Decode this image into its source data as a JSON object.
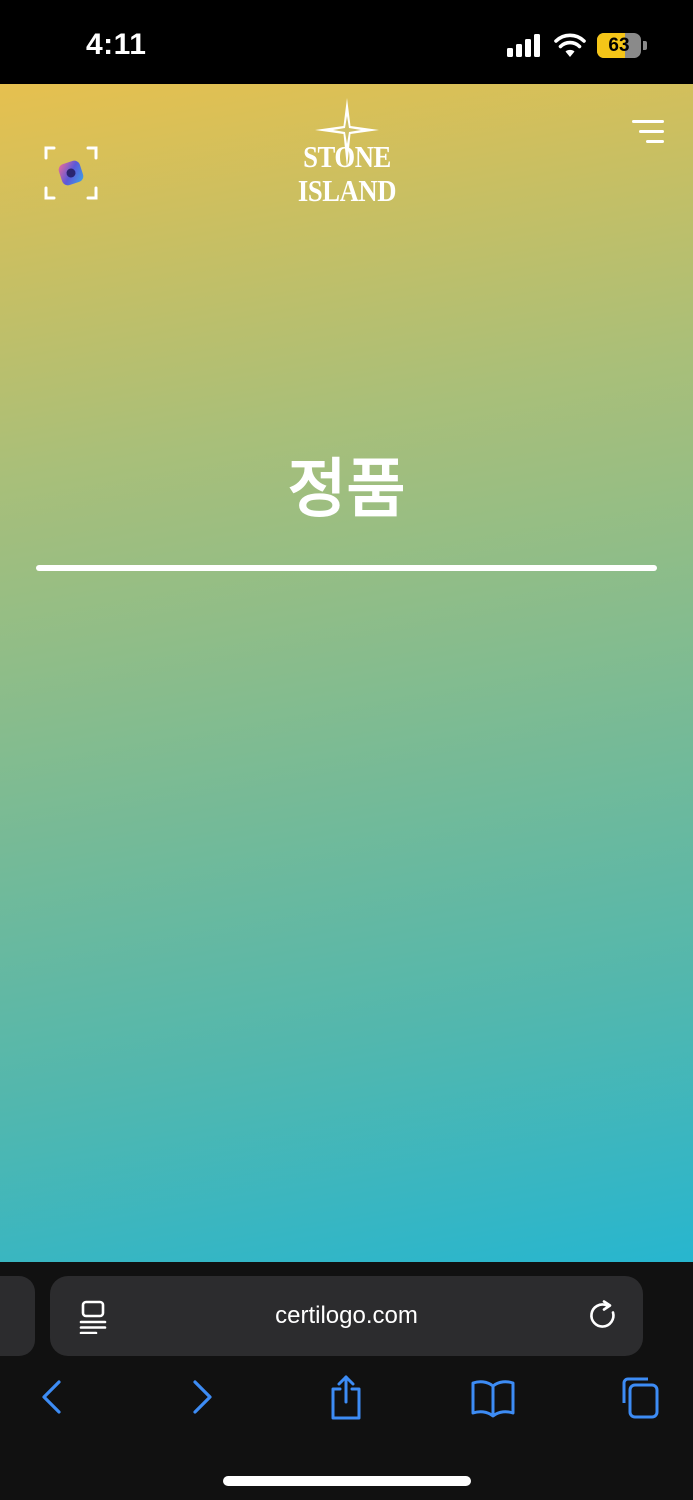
{
  "status_bar": {
    "time": "4:11",
    "battery_level": "63",
    "battery_fraction": 0.63,
    "battery_color": "#f5c518",
    "signal_icon": "cellular-signal-icon",
    "wifi_icon": "wifi-icon"
  },
  "page": {
    "brand": "STONE ISLAND",
    "brand_icon": "compass-star-icon",
    "scan_icon": "scan-frame-icon",
    "menu_icon": "hamburger-menu-icon",
    "verdict": "정품",
    "gradient": {
      "top": "#e6c04f",
      "bottom": "#27b6cf"
    }
  },
  "browser": {
    "url": "certilogo.com",
    "reader_icon": "reader-mode-icon",
    "reload_icon": "reload-icon",
    "accent": "#3d8cf5",
    "toolbar": [
      "back-chevron-icon",
      "forward-chevron-icon",
      "share-icon",
      "bookmarks-book-icon",
      "tabs-icon"
    ]
  }
}
